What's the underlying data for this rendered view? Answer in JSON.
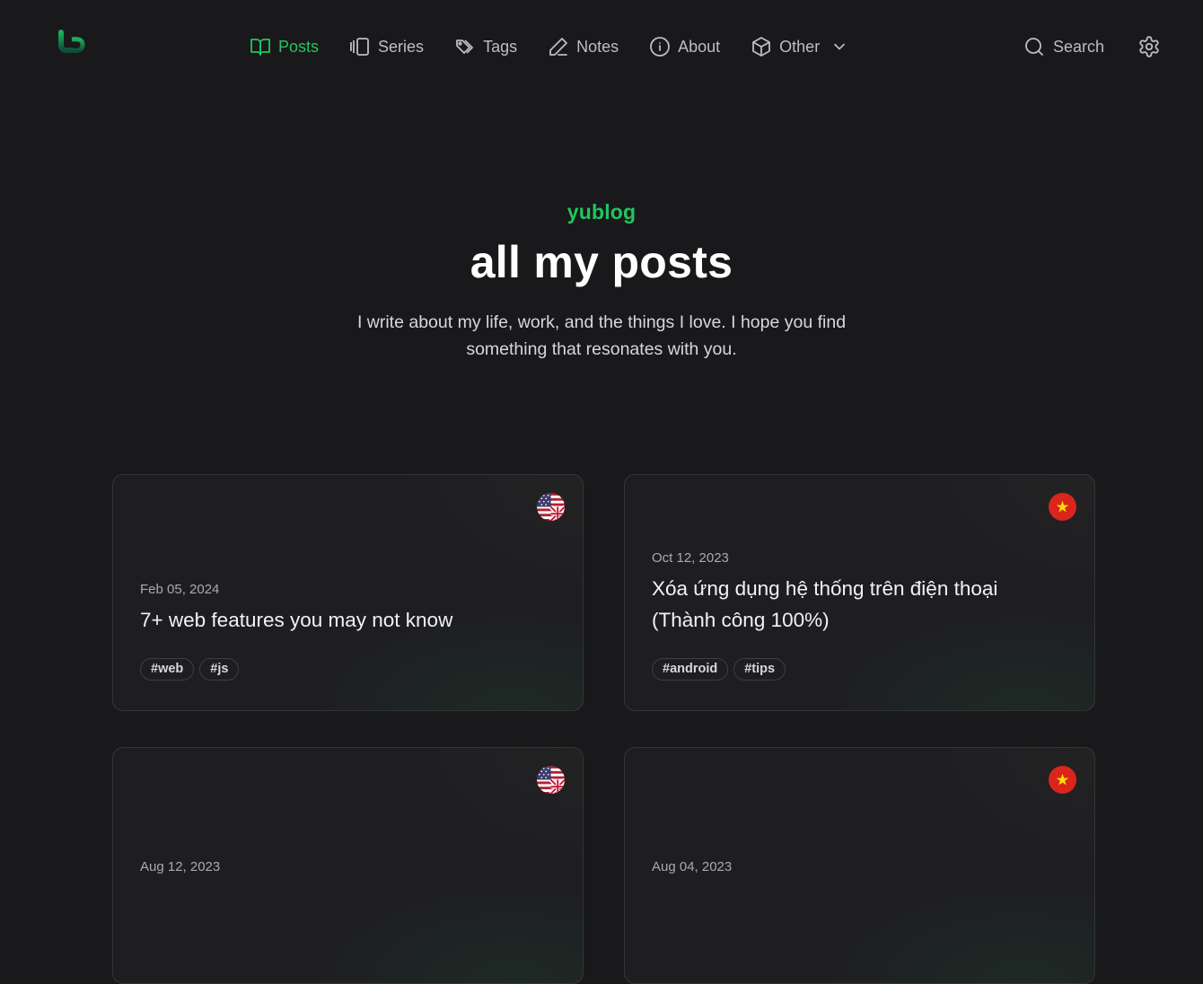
{
  "nav": {
    "items": [
      {
        "label": "Posts",
        "icon": "book-open-icon",
        "active": true
      },
      {
        "label": "Series",
        "icon": "carousel-icon",
        "active": false
      },
      {
        "label": "Tags",
        "icon": "tags-icon",
        "active": false
      },
      {
        "label": "Notes",
        "icon": "pencil-icon",
        "active": false
      },
      {
        "label": "About",
        "icon": "info-icon",
        "active": false
      },
      {
        "label": "Other",
        "icon": "package-icon",
        "active": false
      }
    ],
    "search_label": "Search"
  },
  "hero": {
    "kicker": "yublog",
    "title": "all my posts",
    "subtitle": "I write about my life, work, and the things I love. I hope you find something that resonates with you."
  },
  "posts": [
    {
      "date": "Feb 05, 2024",
      "title": "7+ web features you may not know",
      "tags": [
        "#web",
        "#js"
      ],
      "lang_flag": "us-uk-flag-icon"
    },
    {
      "date": "Oct 12, 2023",
      "title": "Xóa ứng dụng hệ thống trên điện thoại (Thành công 100%)",
      "tags": [
        "#android",
        "#tips"
      ],
      "lang_flag": "vietnam-flag-icon"
    },
    {
      "date": "Aug 12, 2023",
      "title": "",
      "tags": [],
      "lang_flag": "us-uk-flag-icon"
    },
    {
      "date": "Aug 04, 2023",
      "title": "",
      "tags": [],
      "lang_flag": "vietnam-flag-icon"
    }
  ],
  "colors": {
    "accent": "#22c55e",
    "background": "#19191b",
    "card": "#1e1e21"
  }
}
